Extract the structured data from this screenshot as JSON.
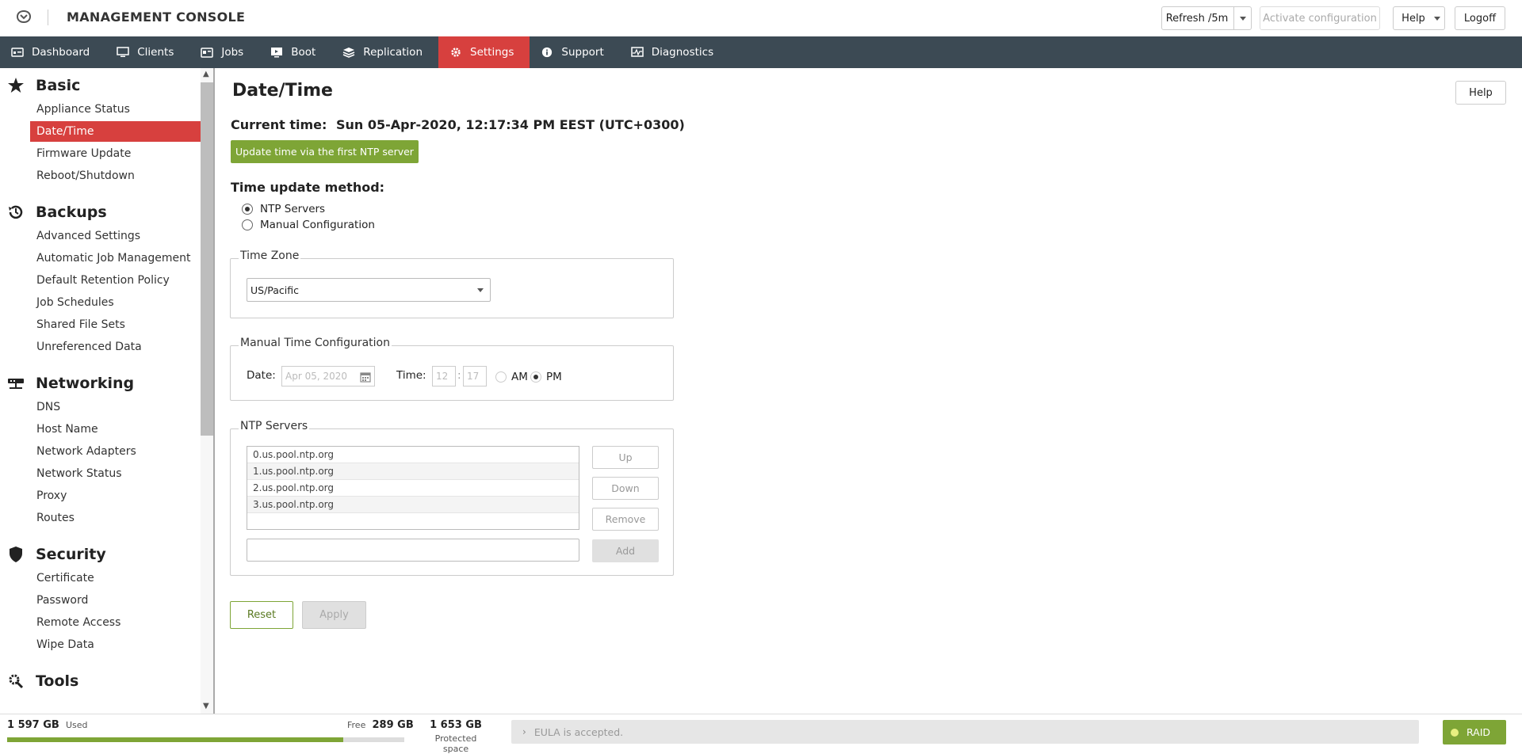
{
  "app": {
    "title": "MANAGEMENT CONSOLE"
  },
  "toolbar": {
    "refresh_label": "Refresh /5m",
    "activate_label": "Activate configuration",
    "help_label": "Help",
    "logoff_label": "Logoff"
  },
  "nav": {
    "items": [
      {
        "label": "Dashboard",
        "icon": "dashboard-icon"
      },
      {
        "label": "Clients",
        "icon": "monitor-icon"
      },
      {
        "label": "Jobs",
        "icon": "jobs-icon"
      },
      {
        "label": "Boot",
        "icon": "boot-icon"
      },
      {
        "label": "Replication",
        "icon": "replication-icon"
      },
      {
        "label": "Settings",
        "icon": "gear-icon",
        "active": true
      },
      {
        "label": "Support",
        "icon": "info-icon"
      },
      {
        "label": "Diagnostics",
        "icon": "diagnostics-icon"
      }
    ]
  },
  "sidebar": {
    "groups": [
      {
        "label": "Basic",
        "icon": "star-icon",
        "items": [
          "Appliance Status",
          "Date/Time",
          "Firmware Update",
          "Reboot/Shutdown"
        ]
      },
      {
        "label": "Backups",
        "icon": "history-icon",
        "items": [
          "Advanced Settings",
          "Automatic Job Management",
          "Default Retention Policy",
          "Job Schedules",
          "Shared File Sets",
          "Unreferenced Data"
        ]
      },
      {
        "label": "Networking",
        "icon": "network-icon",
        "items": [
          "DNS",
          "Host Name",
          "Network Adapters",
          "Network Status",
          "Proxy",
          "Routes"
        ]
      },
      {
        "label": "Security",
        "icon": "shield-icon",
        "items": [
          "Certificate",
          "Password",
          "Remote Access",
          "Wipe Data"
        ]
      },
      {
        "label": "Tools",
        "icon": "tools-icon",
        "items": []
      }
    ],
    "active_item": "Date/Time"
  },
  "main": {
    "title": "Date/Time",
    "help_label": "Help",
    "current_time_label": "Current time:",
    "current_time_value": "Sun 05-Apr-2020, 12:17:34 PM EEST (UTC+0300)",
    "ntp_update_button": "Update time via the first NTP server",
    "method_header": "Time update method:",
    "method_options": [
      "NTP Servers",
      "Manual Configuration"
    ],
    "method_selected": "NTP Servers",
    "timezone": {
      "legend": "Time Zone",
      "value": "US/Pacific"
    },
    "manual": {
      "legend": "Manual Time Configuration",
      "date_label": "Date:",
      "date_value": "Apr 05, 2020",
      "time_label": "Time:",
      "hour": "12",
      "minute": "17",
      "am_label": "AM",
      "pm_label": "PM",
      "period_selected": "PM"
    },
    "ntp": {
      "legend": "NTP Servers",
      "servers": [
        "0.us.pool.ntp.org",
        "1.us.pool.ntp.org",
        "2.us.pool.ntp.org",
        "3.us.pool.ntp.org"
      ],
      "up_label": "Up",
      "down_label": "Down",
      "remove_label": "Remove",
      "add_label": "Add",
      "input_value": ""
    },
    "reset_label": "Reset",
    "apply_label": "Apply"
  },
  "footer": {
    "used_value": "1 597 GB",
    "used_label": "Used",
    "free_label": "Free",
    "free_value": "289 GB",
    "used_fraction": 0.847,
    "protected_value": "1 653 GB",
    "protected_label": "Protected space",
    "eula_text": "EULA is accepted.",
    "raid_label": "RAID"
  },
  "colors": {
    "nav_bg": "#3c4a54",
    "accent_red": "#d7403e",
    "accent_green": "#7ea536"
  }
}
